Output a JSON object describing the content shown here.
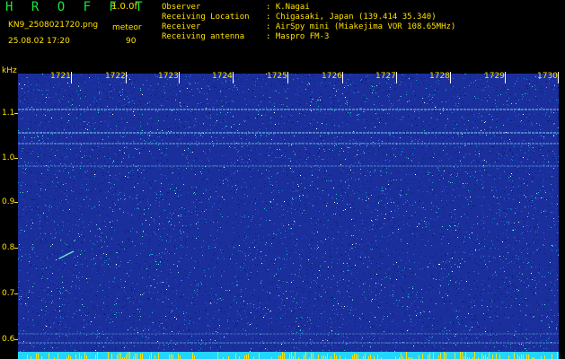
{
  "header": {
    "app_title": "H R O F F T",
    "version": "1.0.0f",
    "filename": "KN9_2508021720.png",
    "mode": "meteor",
    "datetime": "25.08.02 17:20",
    "number": "90"
  },
  "info": [
    {
      "key": "Observer",
      "value": ": K.Nagai"
    },
    {
      "key": "Receiving Location",
      "value": ": Chigasaki, Japan (139.414 35.340)"
    },
    {
      "key": "Receiver",
      "value": ": AirSpy mini (Miakejima VOR 108.65MHz)"
    },
    {
      "key": "Receiving antenna",
      "value": ": Maspro FM-3"
    }
  ],
  "axis": {
    "unit": "kHz",
    "y_labels": [
      "1.1",
      "1.0",
      "0.9",
      "0.8",
      "0.7",
      "0.6"
    ],
    "time_labels": [
      "1721",
      "1722",
      "1723",
      "1724",
      "1725",
      "1726",
      "1727",
      "1728",
      "1729",
      "1730"
    ]
  },
  "colors": {
    "background": "#000000",
    "label": "#ffe000",
    "title": "#19e63a",
    "noise_base": "#1a2f9c",
    "trace": "#8fe0ff",
    "bottom_bar": "#22d4ff"
  }
}
